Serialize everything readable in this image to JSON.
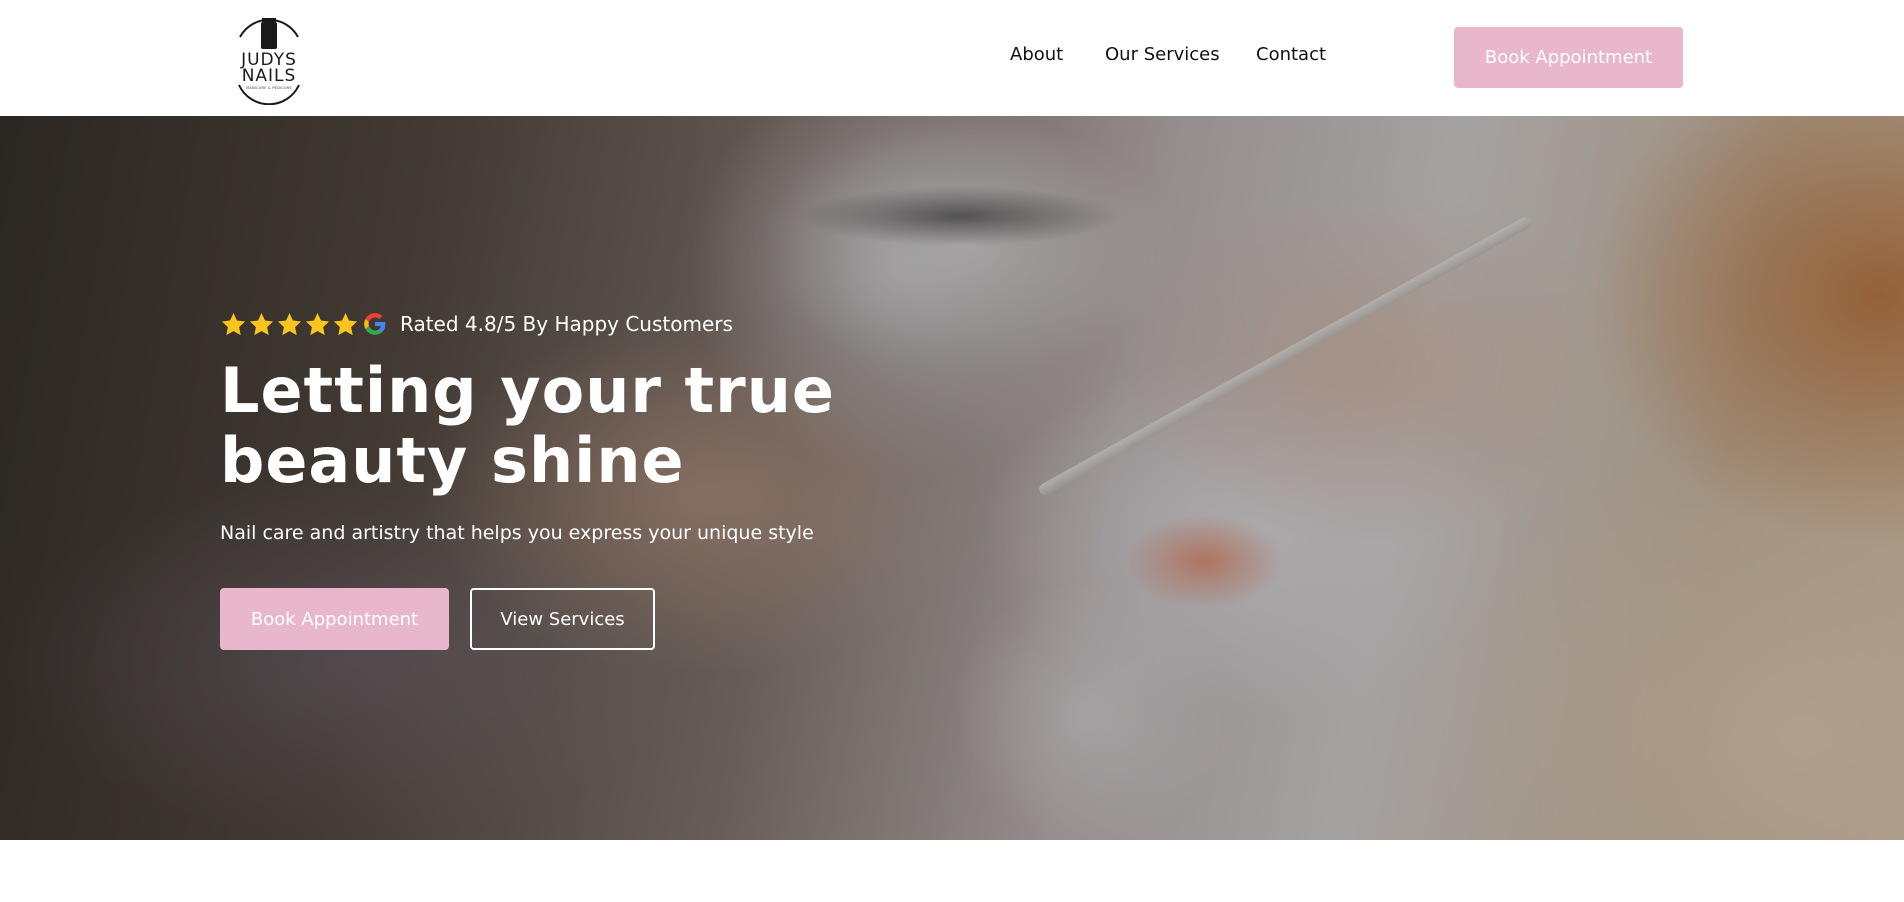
{
  "header": {
    "logo": {
      "line1": "JUDYS",
      "line2": "NAILS",
      "tagline": "manicure & pedicure",
      "icon": "nail-polish-bottle-icon"
    },
    "nav": {
      "items": [
        {
          "label": "About"
        },
        {
          "label": "Our Services"
        },
        {
          "label": "Contact"
        }
      ]
    },
    "book_button_label": "Book Appointment"
  },
  "hero": {
    "rating": {
      "stars": 5,
      "star_icon": "star-icon",
      "google_icon": "google-icon",
      "text": "Rated 4.8/5 By Happy Customers"
    },
    "title": "Letting your true beauty shine",
    "subtitle": "Nail care and artistry that helps you express your unique style",
    "primary_button_label": "Book Appointment",
    "secondary_button_label": "View Services"
  },
  "colors": {
    "accent_pink": "#e8b7cc",
    "star_yellow": "#f8c51c",
    "text_dark": "#111111",
    "white": "#ffffff"
  }
}
